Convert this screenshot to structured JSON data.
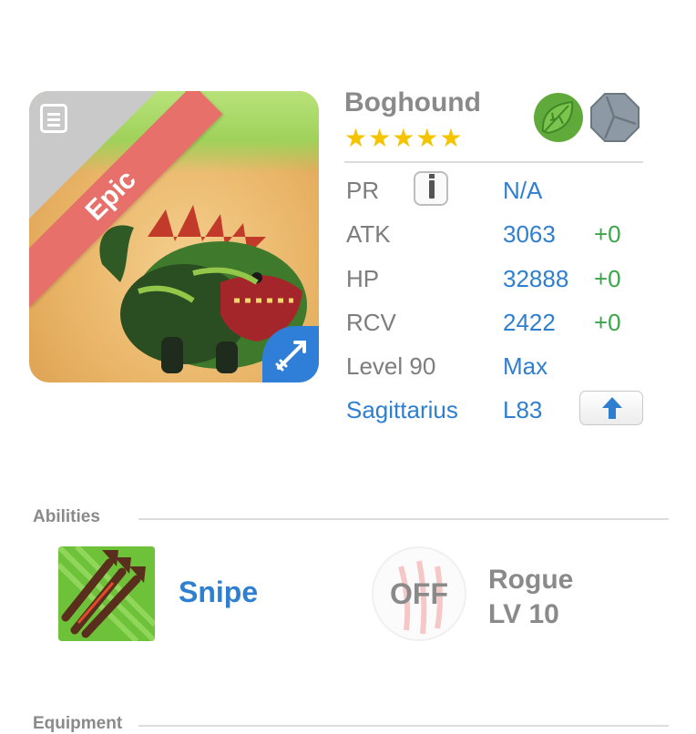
{
  "monster": {
    "name": "Boghound",
    "stars": "★★★★★",
    "rarity": "Epic",
    "elements": [
      "leaf-element-icon",
      "stone-element-icon"
    ]
  },
  "stats": {
    "pr": {
      "label": "PR",
      "value": "N/A"
    },
    "atk": {
      "label": "ATK",
      "value": "3063",
      "bonus": "+0"
    },
    "hp": {
      "label": "HP",
      "value": "32888",
      "bonus": "+0"
    },
    "rcv": {
      "label": "RCV",
      "value": "2422",
      "bonus": "+0"
    },
    "level": {
      "label": "Level 90",
      "value": "Max"
    },
    "sign": {
      "label": "Sagittarius",
      "value": "L83"
    }
  },
  "sections": {
    "abilities": "Abilities",
    "equipment": "Equipment"
  },
  "abilities": {
    "skill_name": "Snipe",
    "trait_state": "OFF",
    "trait_name": "Rogue",
    "trait_level": "LV 10"
  },
  "colors": {
    "accent_blue": "#2f7fd0",
    "bonus_green": "#3aa64a",
    "ribbon_red": "#e8706a",
    "star_gold": "#f5c400"
  }
}
